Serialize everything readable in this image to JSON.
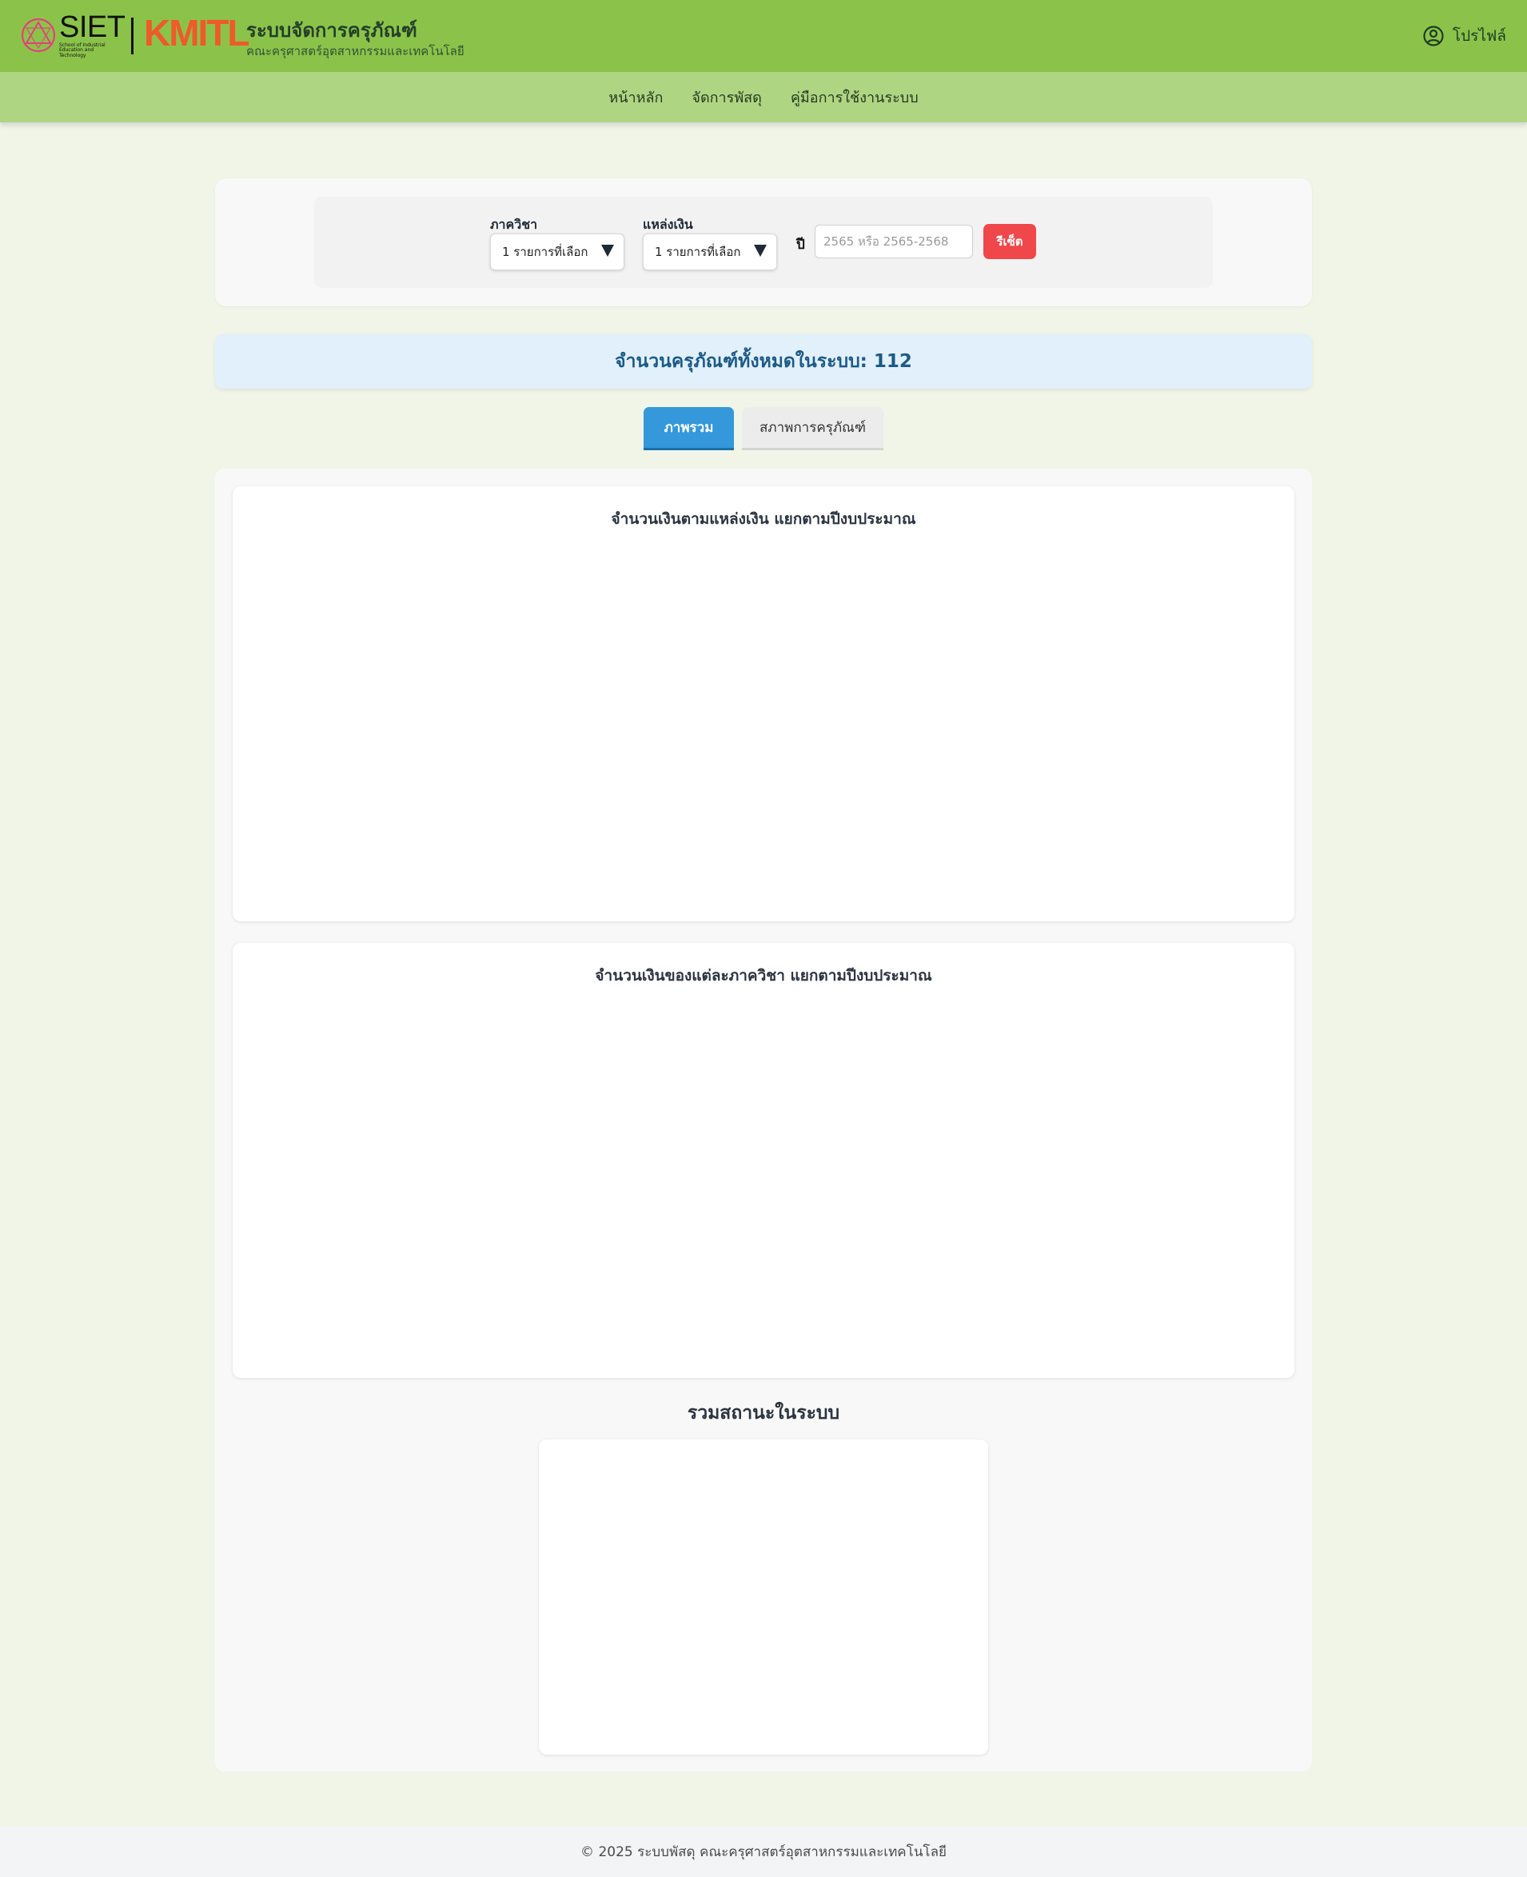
{
  "header": {
    "logo_siet": "SIET",
    "logo_siet_caption": "School of Industrial Education and Technology",
    "logo_kmitl": "KMITL",
    "title": "ระบบจัดการครุภัณฑ์",
    "subtitle": "คณะครุศาสตร์อุตสาหกรรมและเทคโนโลยี",
    "profile_label": "โปรไฟล์"
  },
  "nav": {
    "items": [
      {
        "label": "หน้าหลัก"
      },
      {
        "label": "จัดการพัสดุ"
      },
      {
        "label": "คู่มือการใช้งานระบบ"
      }
    ]
  },
  "filters": {
    "department_label": "ภาควิชา",
    "department_value": "1 รายการที่เลือก",
    "fund_label": "แหล่งเงิน",
    "fund_value": "1 รายการที่เลือก",
    "year_label": "ปี",
    "year_placeholder": "2565 หรือ 2565-2568",
    "year_value": "",
    "reset_label": "รีเซ็ต"
  },
  "summary": {
    "total_text": "จำนวนครุภัณฑ์ทั้งหมดในระบบ: 112"
  },
  "tabs": [
    {
      "label": "ภาพรวม",
      "active": true
    },
    {
      "label": "สภาพการครุภัณฑ์",
      "active": false
    }
  ],
  "charts": {
    "by_fund_title": "จำนวนเงินตามแหล่งเงิน แยกตามปีงบประมาณ",
    "by_department_title": "จำนวนเงินของแต่ละภาควิชา แยกตามปีงบประมาณ",
    "status_title": "รวมสถานะในระบบ"
  },
  "footer": {
    "text": "© 2025 ระบบพัสดุ คณะครุศาสตร์อุตสาหกรรมและเทคโนโลยี"
  },
  "colors": {
    "header_bg": "#8bc34a",
    "nav_bg": "#aed581",
    "page_bg": "#f0f5e8",
    "tab_active": "#3498db",
    "reset_button": "#f0474a",
    "banner_bg": "#e1f0fb",
    "kmitl_orange": "#ef5a2a"
  }
}
